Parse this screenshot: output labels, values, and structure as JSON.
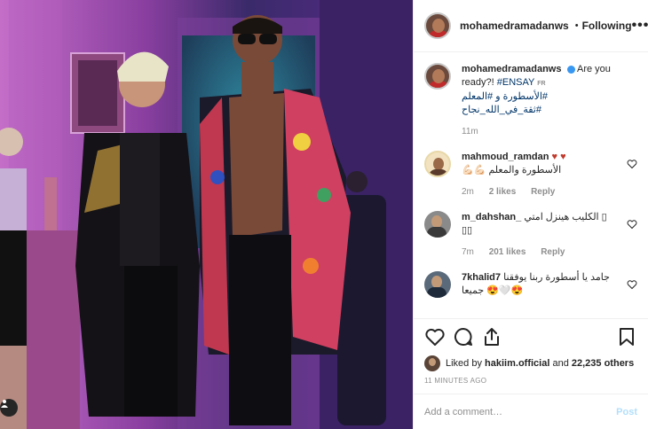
{
  "header": {
    "username": "mohamedramadanws",
    "dot": "•",
    "follow_label": "Following",
    "more": "•••"
  },
  "caption": {
    "username": "mohamedramadanws",
    "text": "Are you ready?!",
    "tag1": "#ENSAY",
    "fr": "FR",
    "line2": "#الأسطورة و #المعلم",
    "line3": "#ثقة_في_الله_نجاح",
    "time": "11m"
  },
  "comments": [
    {
      "username": "mahmoud_ramdan",
      "emoji": "♥ ♥",
      "text": "الأسطورة والمعلم 💪🏻💪🏻",
      "time": "2m",
      "likes": "2 likes",
      "reply": "Reply"
    },
    {
      "username": "m_dahshan_",
      "text": "الكليب هينزل امتي ▯",
      "text2": "▯▯",
      "time": "7m",
      "likes": "201 likes",
      "reply": "Reply"
    },
    {
      "username": "7khalid7",
      "text": "جامد يا أسطورة ربنا يوفقنا",
      "text2": "جميعا 😍🤍😍",
      "time": "",
      "likes": "",
      "reply": ""
    }
  ],
  "likes_line": {
    "prefix": "Liked by",
    "user": "hakiim.official",
    "middle": "and",
    "count": "22,235 others"
  },
  "time_ago": "11 MINUTES AGO",
  "add_comment": {
    "placeholder": "Add a comment…",
    "post_label": "Post"
  },
  "colors": {
    "accent": "#3897f0",
    "heart": "#ed4956",
    "post_disabled": "#b2dffc"
  }
}
